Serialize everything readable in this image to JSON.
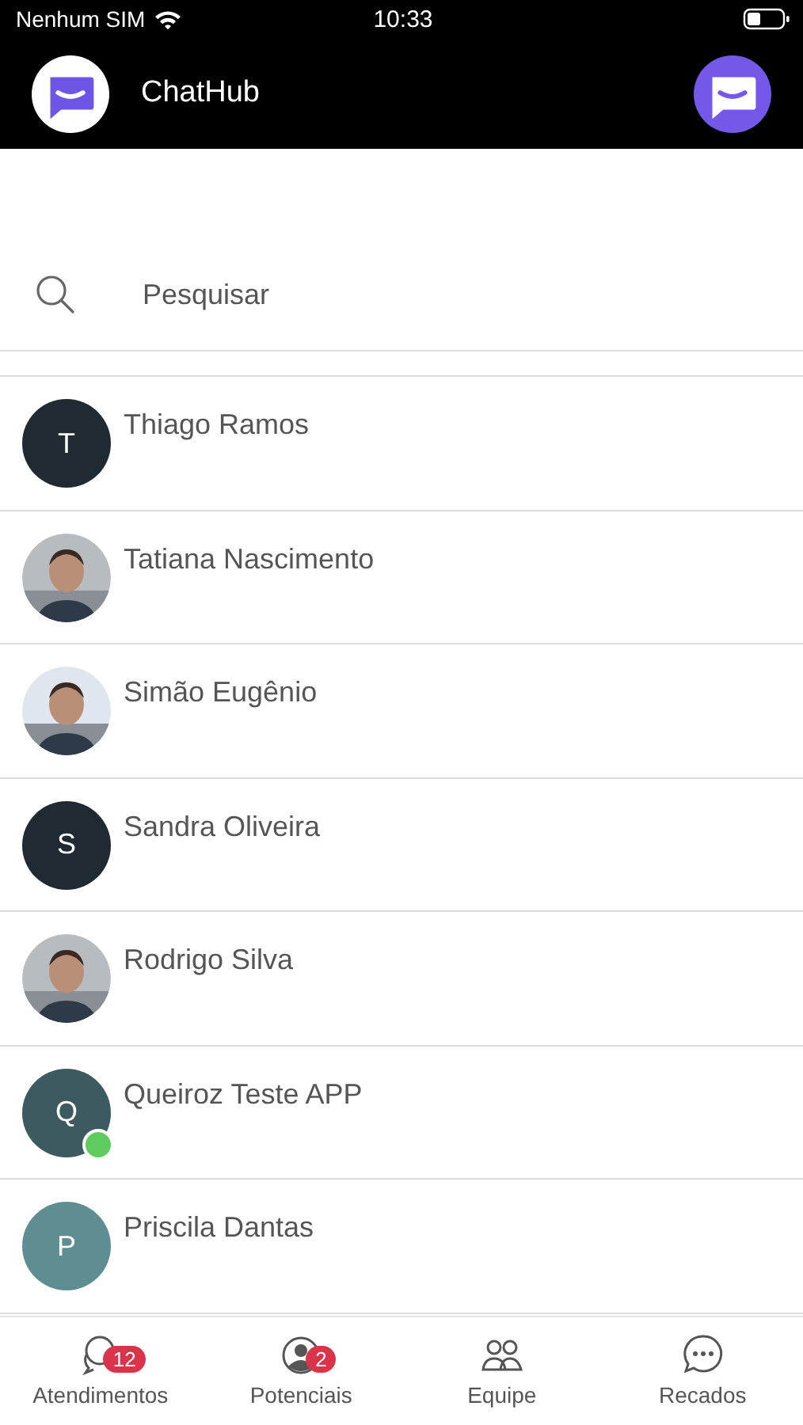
{
  "status_bar": {
    "carrier": "Nenhum SIM",
    "time": "10:33"
  },
  "header": {
    "title": "ChatHub"
  },
  "search": {
    "placeholder": "Pesquisar"
  },
  "contacts": [
    {
      "name": "Thiago Ramos",
      "kind": "initial",
      "initial": "T",
      "color": "#1f2a33",
      "online": false
    },
    {
      "name": "Tatiana Nascimento",
      "kind": "picture",
      "online": false
    },
    {
      "name": "Simão Eugênio",
      "kind": "picture",
      "online": false
    },
    {
      "name": "Sandra Oliveira",
      "kind": "initial",
      "initial": "S",
      "color": "#1f2a33",
      "online": false
    },
    {
      "name": "Rodrigo Silva",
      "kind": "picture",
      "online": false
    },
    {
      "name": "Queiroz Teste APP",
      "kind": "initial",
      "initial": "Q",
      "color": "#3e5a61",
      "online": true
    },
    {
      "name": "Priscila Dantas",
      "kind": "initial",
      "initial": "P",
      "color": "#5e8e92",
      "online": false
    }
  ],
  "tabs": [
    {
      "label": "Atendimentos",
      "kind": "chats",
      "badge": "12",
      "selected": false
    },
    {
      "label": "Potenciais",
      "kind": "person",
      "badge": "2",
      "selected": false
    },
    {
      "label": "Equipe",
      "kind": "team",
      "selected": false
    },
    {
      "label": "Recados",
      "kind": "message",
      "selected": false
    }
  ]
}
